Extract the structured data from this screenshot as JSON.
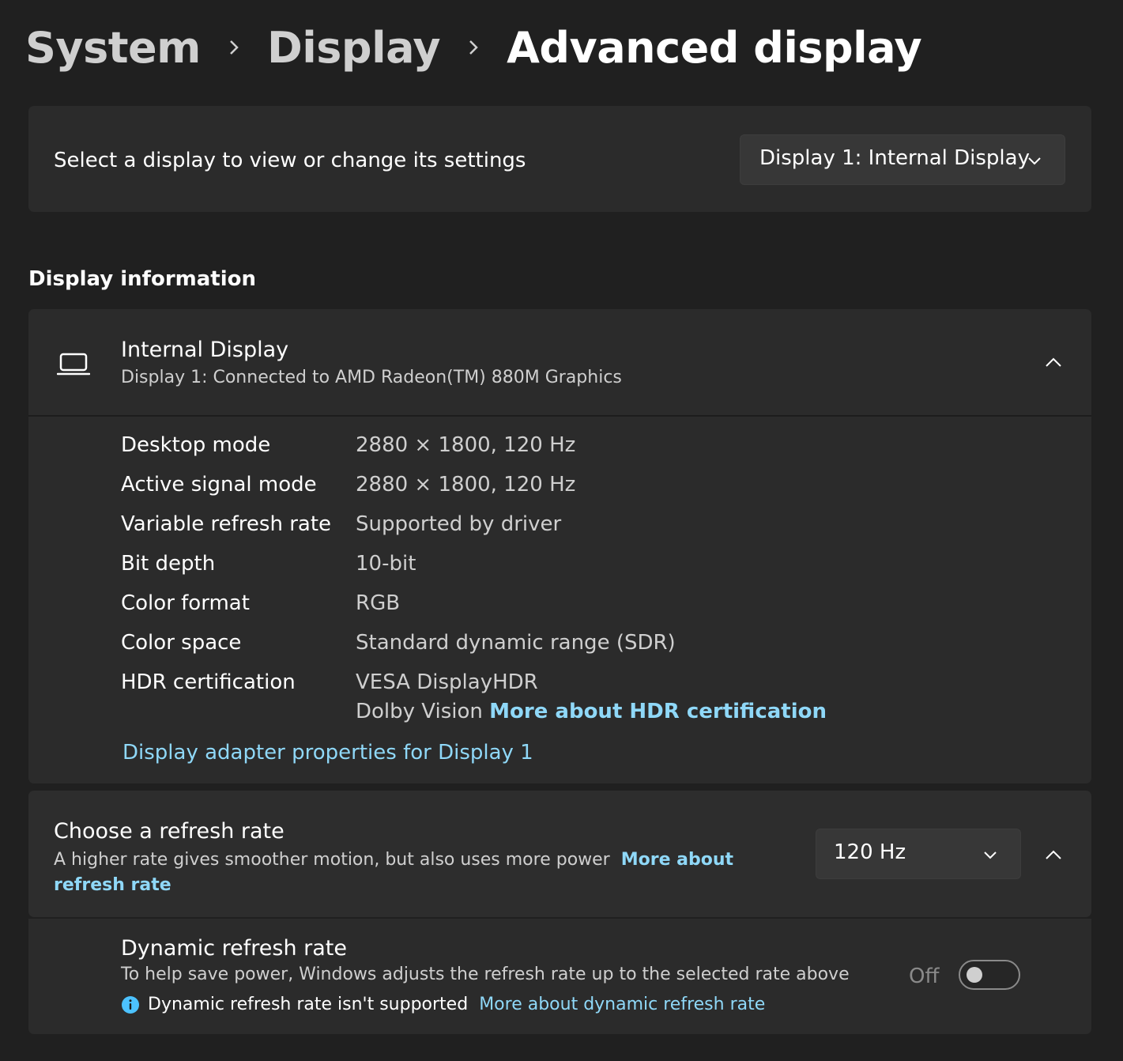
{
  "breadcrumb": {
    "items": [
      "System",
      "Display",
      "Advanced display"
    ]
  },
  "display_select": {
    "label": "Select a display to view or change its settings",
    "dropdown_value": "Display 1: Internal Display"
  },
  "display_information": {
    "section_title": "Display information",
    "header_title": "Internal Display",
    "header_subtitle": "Display 1: Connected to AMD Radeon(TM) 880M Graphics",
    "properties": [
      {
        "label": "Desktop mode",
        "value": "2880 × 1800, 120 Hz"
      },
      {
        "label": "Active signal mode",
        "value": "2880 × 1800, 120 Hz"
      },
      {
        "label": "Variable refresh rate",
        "value": "Supported by driver"
      },
      {
        "label": "Bit depth",
        "value": "10-bit"
      },
      {
        "label": "Color format",
        "value": "RGB"
      },
      {
        "label": "Color space",
        "value": "Standard dynamic range (SDR)"
      },
      {
        "label": "HDR certification",
        "value": "VESA DisplayHDR",
        "value2": "Dolby Vision",
        "link": "More about HDR certification"
      }
    ],
    "adapter_link": "Display adapter properties for Display 1"
  },
  "refresh_rate": {
    "title": "Choose a refresh rate",
    "description": "A higher rate gives smoother motion, but also uses more power",
    "link": "More about refresh rate",
    "dropdown_value": "120 Hz"
  },
  "dynamic_refresh": {
    "title": "Dynamic refresh rate",
    "description": "To help save power, Windows adjusts the refresh rate up to the selected rate above",
    "warning": "Dynamic refresh rate isn't supported",
    "link": "More about dynamic refresh rate",
    "toggle_label": "Off",
    "toggle_on": false
  },
  "icons": {
    "breadcrumb_separator": "chevron-right-icon",
    "dropdown": "chevron-down-icon",
    "collapse": "chevron-up-icon",
    "display": "laptop-icon",
    "info": "info-icon"
  },
  "colors": {
    "background": "#202020",
    "card": "#2b2b2b",
    "link": "#8fd8f8",
    "info_icon": "#4cc2ff"
  }
}
